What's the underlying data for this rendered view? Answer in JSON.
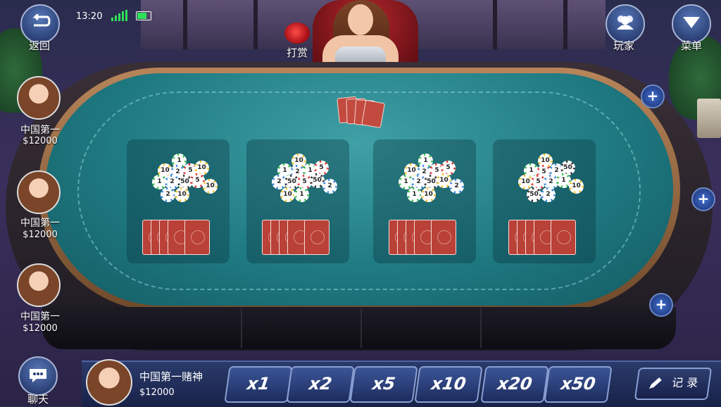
{
  "status": {
    "time": "13:20"
  },
  "top_left": {
    "back_label": "返回"
  },
  "dealer": {
    "tip_label": "打赏"
  },
  "top_right": {
    "players_label": "玩家",
    "menu_label": "菜单"
  },
  "players": [
    {
      "name": "中国第一",
      "money": "$12000"
    },
    {
      "name": "中国第一",
      "money": "$12000"
    },
    {
      "name": "中国第一",
      "money": "$12000"
    }
  ],
  "chat": {
    "label": "聊天"
  },
  "self": {
    "name": "中国第一赌神",
    "money": "$12000"
  },
  "multipliers": [
    "x1",
    "x2",
    "x5",
    "x10",
    "x20",
    "x50"
  ],
  "record": {
    "label": "记 录"
  },
  "zones": [
    {
      "chips": [
        "1",
        "10",
        "2",
        "5",
        "10",
        "1",
        "2",
        "50",
        "5",
        "10",
        "2",
        "10"
      ]
    },
    {
      "chips": [
        "10",
        "1",
        "2",
        "1",
        "5",
        "2",
        "50",
        "5",
        "50",
        "2",
        "10",
        "1"
      ]
    },
    {
      "chips": [
        "1",
        "10",
        "2",
        "5",
        "5",
        "1",
        "2",
        "50",
        "10",
        "2",
        "1",
        "10"
      ]
    },
    {
      "chips": [
        "10",
        "1",
        "5",
        "2",
        "50",
        "10",
        "5",
        "2",
        "1",
        "10",
        "50",
        "2"
      ]
    }
  ],
  "colors": {
    "chip_1": "#3cbf4f",
    "chip_2": "#3f8ae0",
    "chip_5": "#e23a3a",
    "chip_10": "#f2c230",
    "chip_50": "#333333"
  }
}
